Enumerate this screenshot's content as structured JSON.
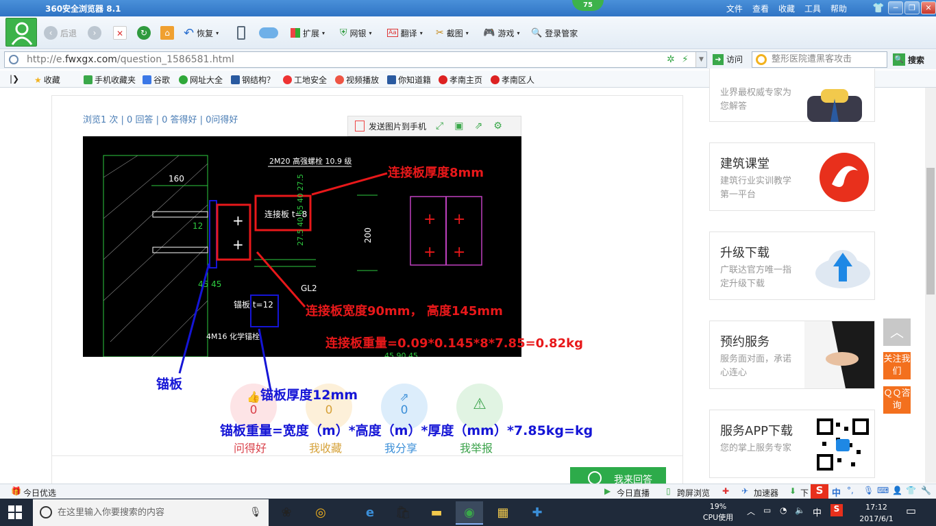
{
  "browser": {
    "title": "360安全浏览器 8.1",
    "menus": [
      "文件",
      "查看",
      "收藏",
      "工具",
      "帮助"
    ],
    "badge": "75",
    "toolbar": {
      "back": "后退",
      "restore": "恢复",
      "extend": "扩展",
      "netbank": "网银",
      "translate": "翻译",
      "screenshot": "截图",
      "games": "游戏",
      "login_manager": "登录管家"
    },
    "url": {
      "prefix": "http://e.",
      "host": "fwxgx.com",
      "path": "/question_1586581.html"
    },
    "visit": "访问",
    "search_placeholder": "整形医院遭黑客攻击",
    "search_btn": "搜索",
    "favorites": [
      "收藏",
      "手机收藏夹",
      "谷歌",
      "网址大全",
      "钢结构？",
      "工地安全",
      "视频播放",
      "你知道籍",
      "孝南主页",
      "孝南区人"
    ]
  },
  "question": {
    "stats": "浏览1 次 | 0 回答 | 0 答得好 | 0问得好",
    "send_to_phone": "发送图片到手机",
    "cad": {
      "bolt_label": "2M20 高强螺栓 10.9 级",
      "dim_160": "160",
      "dim_12": "12",
      "plate_label": "连接板 t=8",
      "anchor_label": "锚板 t=12",
      "chem_bolt": "4M16 化学锚栓",
      "gl2": "GL2",
      "dims_right": "27.5 40 65 40 27.5",
      "dim_200": "200",
      "dim_4545": "45 45",
      "bottom_text": "45  90  45"
    },
    "annotations": {
      "plate_thickness": "连接板厚度8mm",
      "plate_size": "连接板宽度90mm，  高度145mm",
      "plate_weight": "连接板重量=0.09*0.145*8*7.85=0.82kg",
      "anchor": "锚板",
      "anchor_thickness": "锚板厚度12mm",
      "anchor_weight": "锚板重量=宽度（m）*高度（m）*厚度（mm）*7.85kg=kg"
    },
    "actions": [
      {
        "count": "0",
        "label": "问得好",
        "color": "#d9414a",
        "bg": "#fde4e6",
        "icon": "thumb-up-icon"
      },
      {
        "count": "0",
        "label": "我收藏",
        "color": "#d6a23a",
        "bg": "#fdf0d9",
        "icon": "star-icon"
      },
      {
        "count": "0",
        "label": "我分享",
        "color": "#3b8fd8",
        "bg": "#dcedfb",
        "icon": "share-icon"
      },
      {
        "count": "",
        "label": "我举报",
        "color": "#3aa24a",
        "bg": "#e1f4e3",
        "icon": "warning-icon"
      }
    ],
    "answer_btn": "我来回答"
  },
  "sidebar": {
    "top_card": {
      "desc": "业界最权威专家为您解答"
    },
    "cards": [
      {
        "title": "建筑课堂",
        "desc": "建筑行业实训教学第一平台"
      },
      {
        "title": "升级下载",
        "desc": "广联达官方唯一指定升级下载"
      },
      {
        "title": "预约服务",
        "desc": "服务面对面，承诺心连心"
      },
      {
        "title": "服务APP下载",
        "desc": "您的掌上服务专家"
      }
    ],
    "float": {
      "follow": "关注我们",
      "qq": "ＱＱ咨询"
    }
  },
  "statusbar": {
    "today_pick": "今日优选",
    "today_live": "今日直播",
    "cross_screen": "跨屏浏览",
    "accelerator": "加速器",
    "download": "下载",
    "ime": "中"
  },
  "taskbar": {
    "search_placeholder": "在这里输入你要搜索的内容",
    "cpu_pct": "19%",
    "cpu_label": "CPU使用",
    "ime": "中",
    "time": "17:12",
    "date": "2017/6/1"
  }
}
